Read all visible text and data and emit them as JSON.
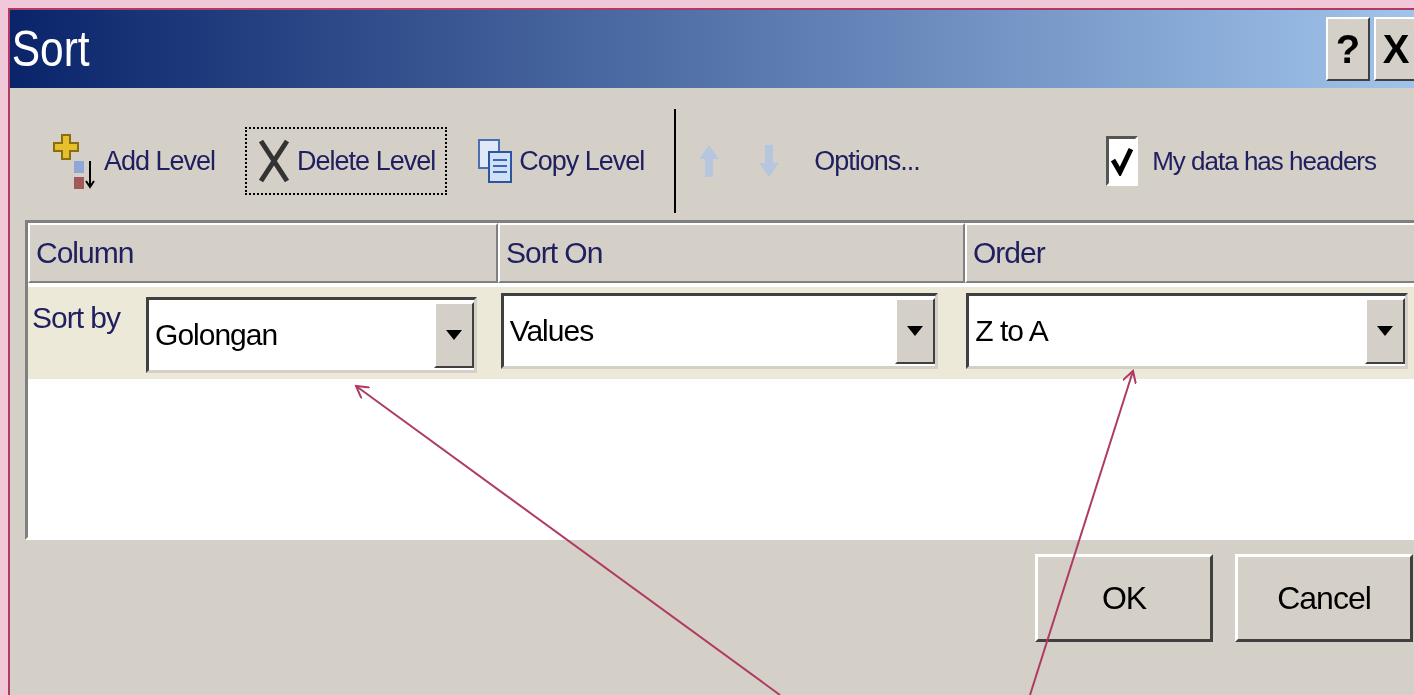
{
  "window": {
    "title": "Sort",
    "buttons": [
      "?",
      "X"
    ]
  },
  "toolbar": [
    {
      "kind": "add",
      "label": "Add Level",
      "focused": false,
      "disabled": false
    },
    {
      "kind": "delete",
      "label": "Delete Level",
      "focused": true,
      "disabled": false
    },
    {
      "kind": "copy",
      "label": "Copy Level",
      "focused": false,
      "disabled": false
    },
    {
      "kind": "up",
      "disabled": true
    },
    {
      "kind": "down",
      "disabled": true
    },
    {
      "kind": "options",
      "label": "Options...",
      "focused": false,
      "disabled": false
    }
  ],
  "headers_checkbox": {
    "label": "My data has headers",
    "checked": true
  },
  "grid": {
    "columns": [
      "Column",
      "Sort On",
      "Order"
    ],
    "levels": [
      {
        "label": "Sort by",
        "column": "Golongan",
        "sort_on": "Values",
        "order": "Z to A",
        "selected": true
      }
    ]
  },
  "buttons": [
    "OK",
    "Cancel"
  ]
}
